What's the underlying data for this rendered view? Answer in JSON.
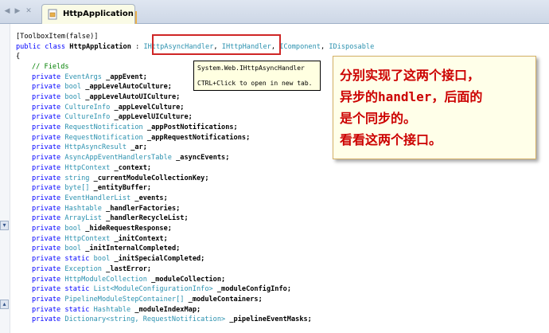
{
  "colors": {
    "keyword": "#0000ff",
    "type": "#2b91af",
    "comment": "#008000",
    "annotation_text": "#cc0000",
    "highlight_border": "#cf2626",
    "tooltip_bg": "#ffffe1",
    "note_bg": "#ffffe9"
  },
  "tabs": [
    {
      "label": "HttpApplication",
      "icon": "class-file-icon",
      "active": true
    }
  ],
  "nav": {
    "back_icon": "back-arrow-icon",
    "forward_icon": "forward-arrow-icon",
    "close_icon": "close-icon"
  },
  "code": {
    "attribute": "[ToolboxItem(false)]",
    "decl": {
      "mod1": "public",
      "mod2": "class",
      "class_name": "HttpApplication",
      "colon": " : ",
      "iface1": "IHttpAsyncHandler",
      "sep1": ", ",
      "iface2": "IHttpHandler",
      "sep2": ", ",
      "iface3": "IComponent",
      "sep3": ", ",
      "iface4": "IDisposable"
    },
    "open_brace": "{",
    "comment": "// Fields",
    "fields": [
      {
        "mod": "private",
        "type": "EventArgs",
        "name": "_appEvent;"
      },
      {
        "mod": "private",
        "type": "bool",
        "name": "_appLevelAutoCulture;"
      },
      {
        "mod": "private",
        "type": "bool",
        "name": "_appLevelAutoUICulture;"
      },
      {
        "mod": "private",
        "type": "CultureInfo",
        "name": "_appLevelCulture;"
      },
      {
        "mod": "private",
        "type": "CultureInfo",
        "name": "_appLevelUICulture;"
      },
      {
        "mod": "private",
        "type": "RequestNotification",
        "name": "_appPostNotifications;"
      },
      {
        "mod": "private",
        "type": "RequestNotification",
        "name": "_appRequestNotifications;"
      },
      {
        "mod": "private",
        "type": "HttpAsyncResult",
        "name": "_ar;"
      },
      {
        "mod": "private",
        "type": "AsyncAppEventHandlersTable",
        "name": "_asyncEvents;"
      },
      {
        "mod": "private",
        "type": "HttpContext",
        "name": "_context;"
      },
      {
        "mod": "private",
        "type": "string",
        "name": "_currentModuleCollectionKey;"
      },
      {
        "mod": "private",
        "type": "byte[]",
        "name": "_entityBuffer;"
      },
      {
        "mod": "private",
        "type": "EventHandlerList",
        "name": "_events;"
      },
      {
        "mod": "private",
        "type": "Hashtable",
        "name": "_handlerFactories;"
      },
      {
        "mod": "private",
        "type": "ArrayList",
        "name": "_handlerRecycleList;"
      },
      {
        "mod": "private",
        "type": "bool",
        "name": "_hideRequestResponse;"
      },
      {
        "mod": "private",
        "type": "HttpContext",
        "name": "_initContext;"
      },
      {
        "mod": "private",
        "type": "bool",
        "name": "_initInternalCompleted;"
      },
      {
        "mod": "private static",
        "type": "bool",
        "name": "_initSpecialCompleted;"
      },
      {
        "mod": "private",
        "type": "Exception",
        "name": "_lastError;"
      },
      {
        "mod": "private",
        "type": "HttpModuleCollection",
        "name": "_moduleCollection;"
      },
      {
        "mod": "private static",
        "type": "List<ModuleConfigurationInfo>",
        "name": "_moduleConfigInfo;"
      },
      {
        "mod": "private",
        "type": "PipelineModuleStepContainer[]",
        "name": "_moduleContainers;"
      },
      {
        "mod": "private static",
        "type": "Hashtable",
        "name": "_moduleIndexMap;"
      },
      {
        "mod": "private",
        "type": "Dictionary<string, RequestNotification>",
        "name": "_pipelineEventMasks;"
      }
    ]
  },
  "tooltip": {
    "line1": "System.Web.IHttpAsyncHandler",
    "line2": "CTRL+Click to open in new tab."
  },
  "annotation": {
    "lines": [
      "分别实现了这两个接口，",
      "异步的handler，后面的",
      "是个同步的。",
      "看看这两个接口。"
    ]
  }
}
